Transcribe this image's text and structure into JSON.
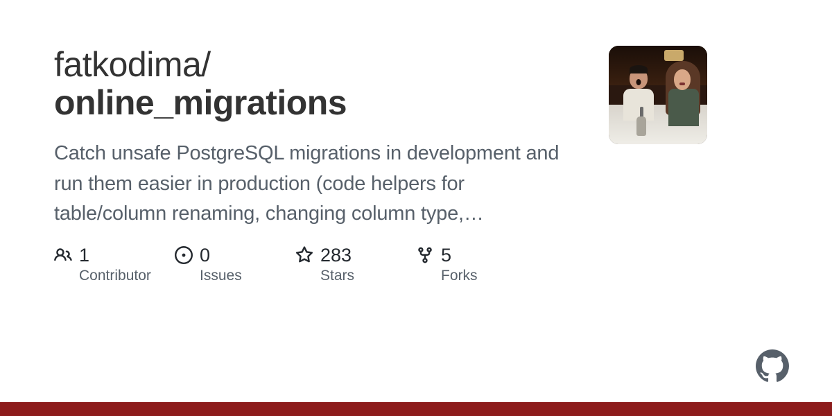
{
  "repo": {
    "owner": "fatkodima",
    "slash": "/",
    "name": "online_migrations",
    "description": "Catch unsafe PostgreSQL migrations in development and run them easier in production (code helpers for table/column renaming, changing column type,…"
  },
  "stats": {
    "contributors": {
      "value": "1",
      "label": "Contributor"
    },
    "issues": {
      "value": "0",
      "label": "Issues"
    },
    "stars": {
      "value": "283",
      "label": "Stars"
    },
    "forks": {
      "value": "5",
      "label": "Forks"
    }
  },
  "colors": {
    "accent_bar": "#8d1c1c"
  }
}
